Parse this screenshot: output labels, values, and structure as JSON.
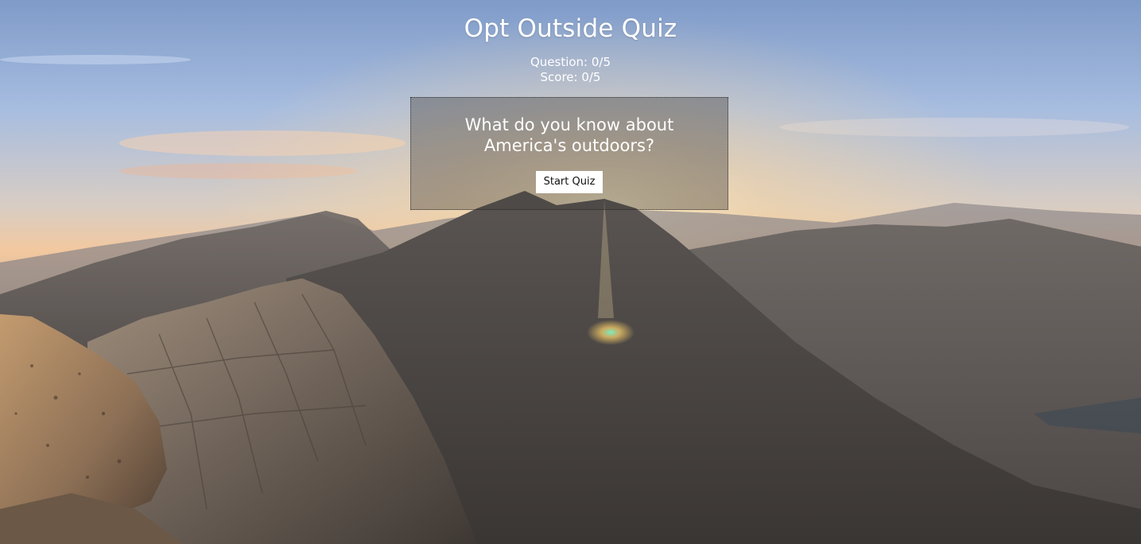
{
  "header": {
    "title": "Opt Outside Quiz",
    "question_progress": "Question: 0/5",
    "score": "Score: 0/5"
  },
  "quiz": {
    "intro_question": "What do you know about America's outdoors?",
    "start_label": "Start Quiz"
  },
  "background": {
    "description_icon": "mountain-sunset-background",
    "colors": {
      "sky_top": "#8fa7cf",
      "horizon_glow": "#f4c79a",
      "haze": "#c9b8a8",
      "rock_dark": "#3f3c3a",
      "rock_light": "#8a7a6d"
    }
  }
}
